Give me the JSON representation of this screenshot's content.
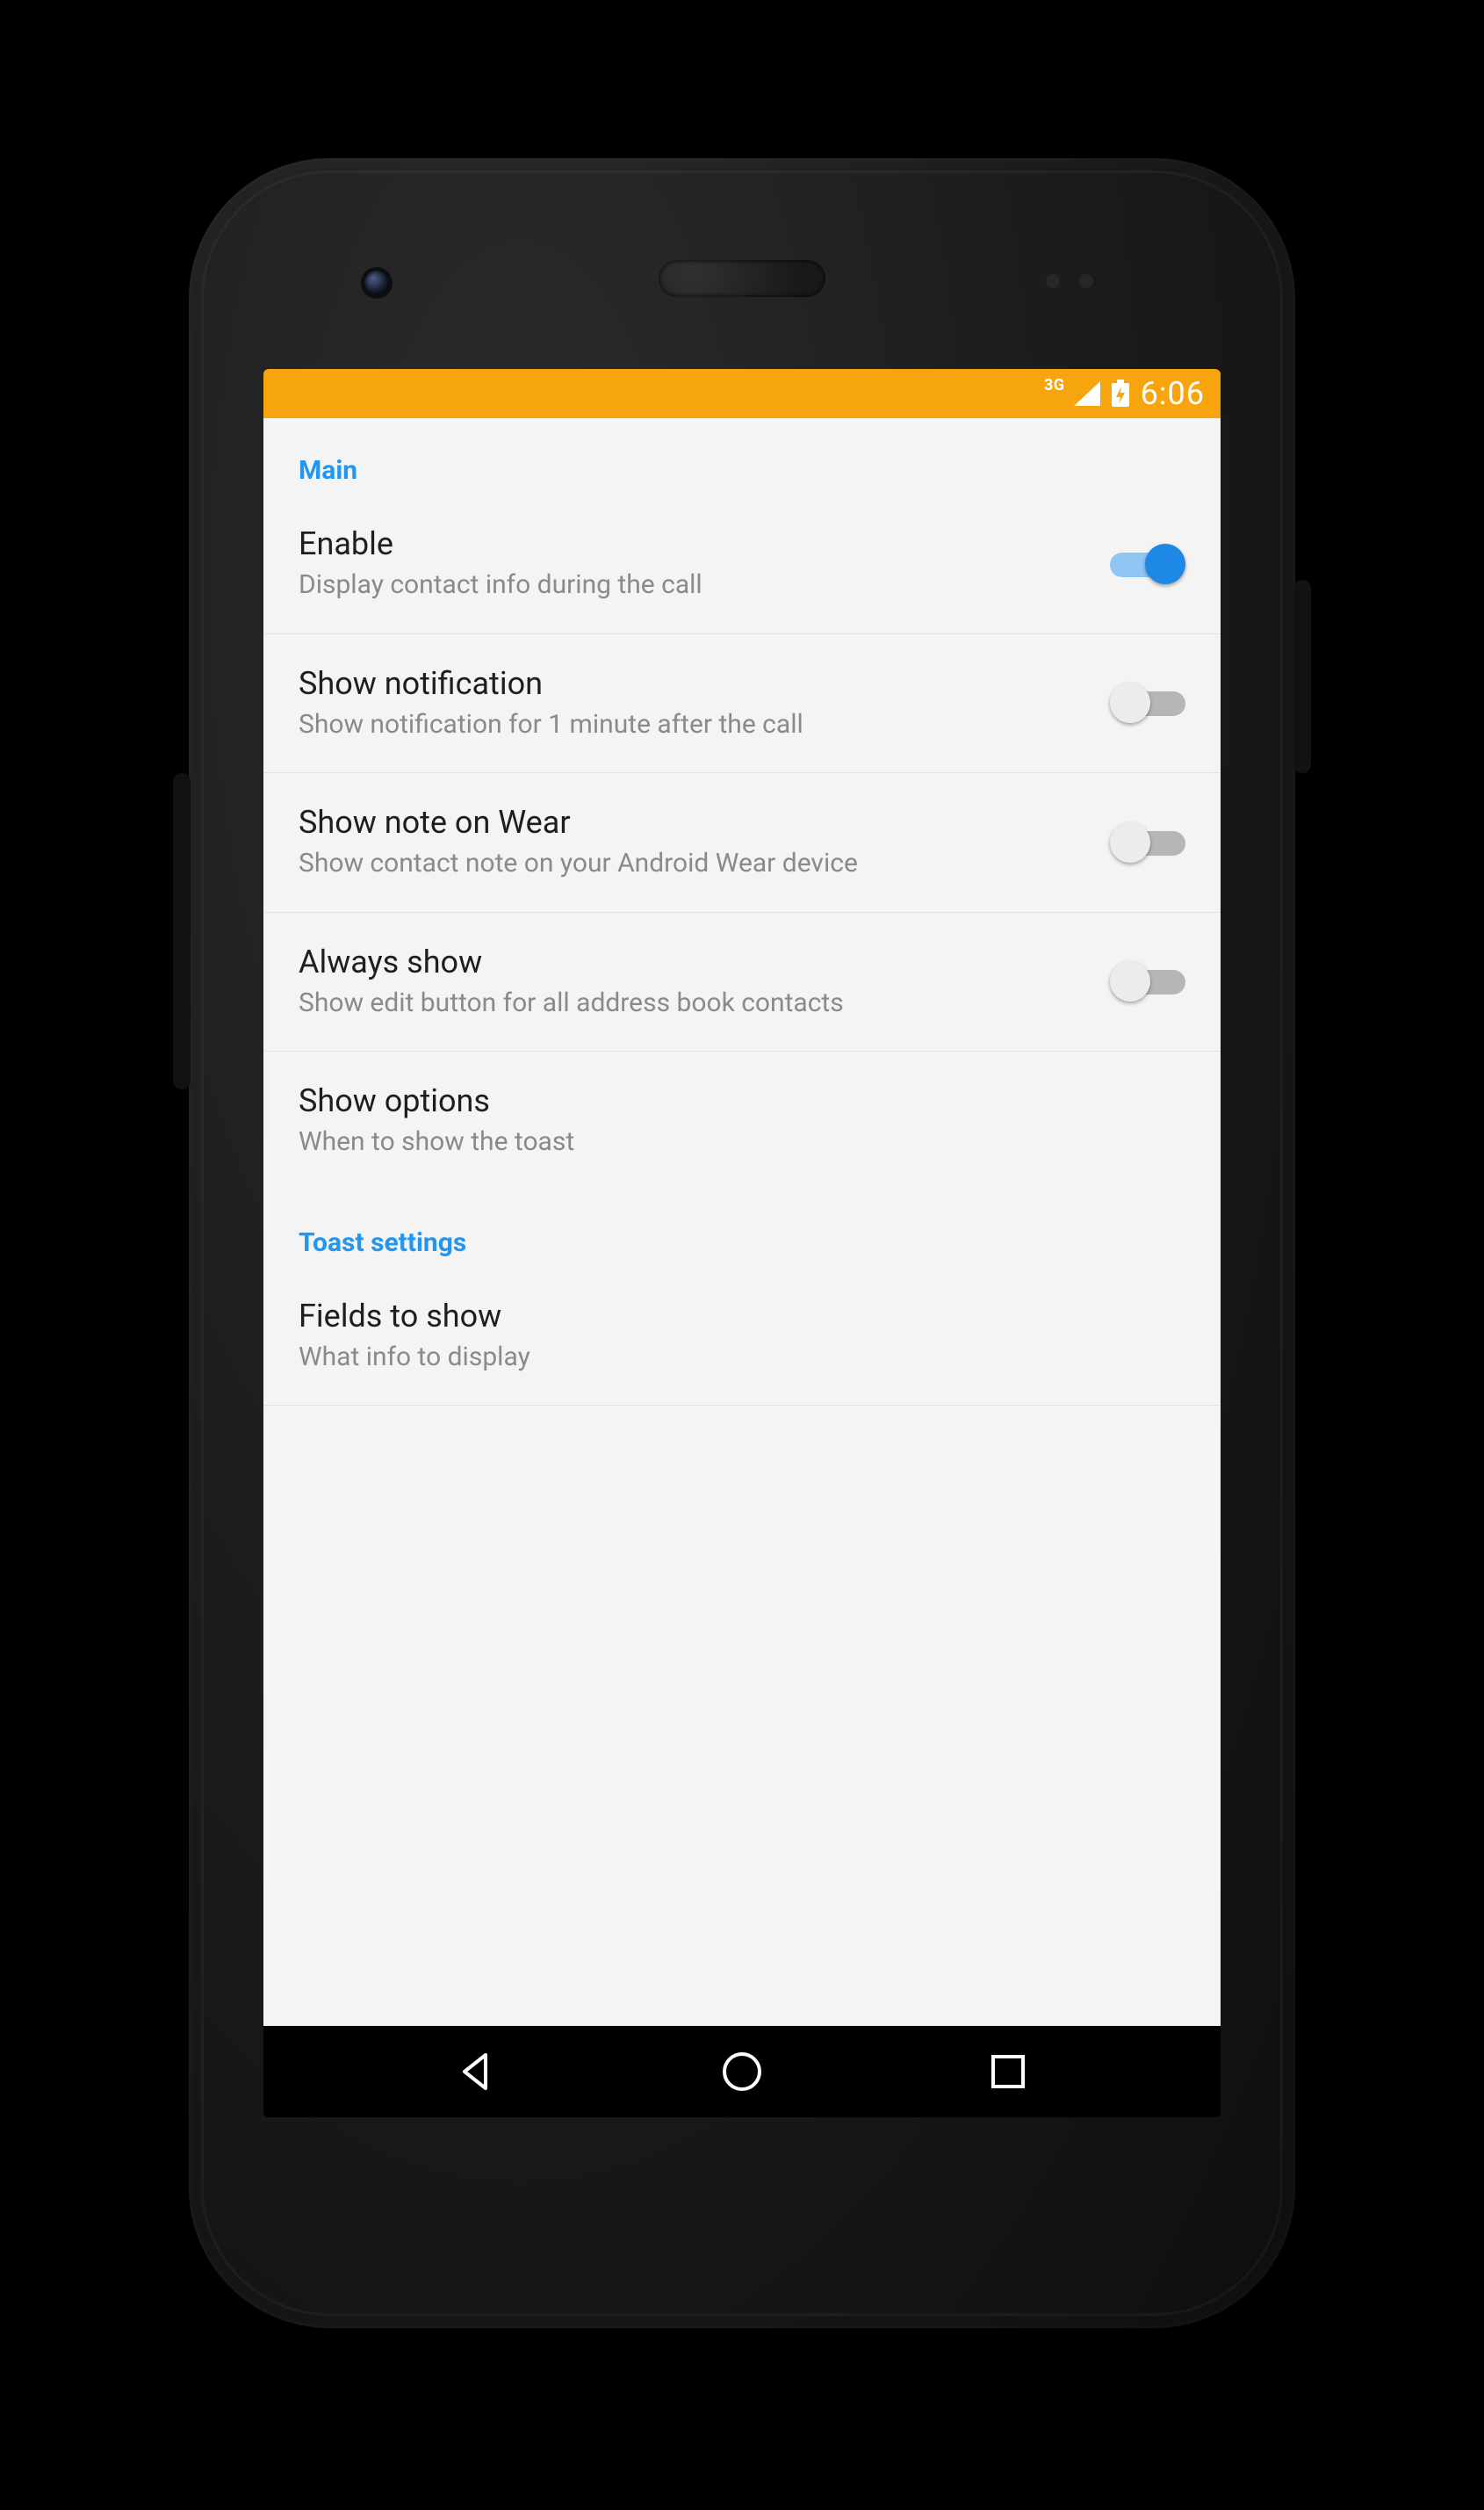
{
  "statusbar": {
    "network_label": "3G",
    "clock": "6:06"
  },
  "sections": {
    "main": {
      "header": "Main",
      "items": {
        "enable": {
          "title": "Enable",
          "subtitle": "Display contact info during the call",
          "checked": true
        },
        "notification": {
          "title": "Show notification",
          "subtitle": "Show notification for 1 minute after the call",
          "checked": false
        },
        "wear": {
          "title": "Show note on Wear",
          "subtitle": "Show contact note on your Android Wear device",
          "checked": false
        },
        "always_show": {
          "title": "Always show",
          "subtitle": "Show edit button for all address book contacts",
          "checked": false
        },
        "show_options": {
          "title": "Show options",
          "subtitle": "When to show the toast"
        }
      }
    },
    "toast": {
      "header": "Toast settings",
      "items": {
        "fields": {
          "title": "Fields to show",
          "subtitle": "What info to display"
        }
      }
    }
  },
  "colors": {
    "accent": "#2196f3",
    "statusbar": "#f7a50f"
  }
}
